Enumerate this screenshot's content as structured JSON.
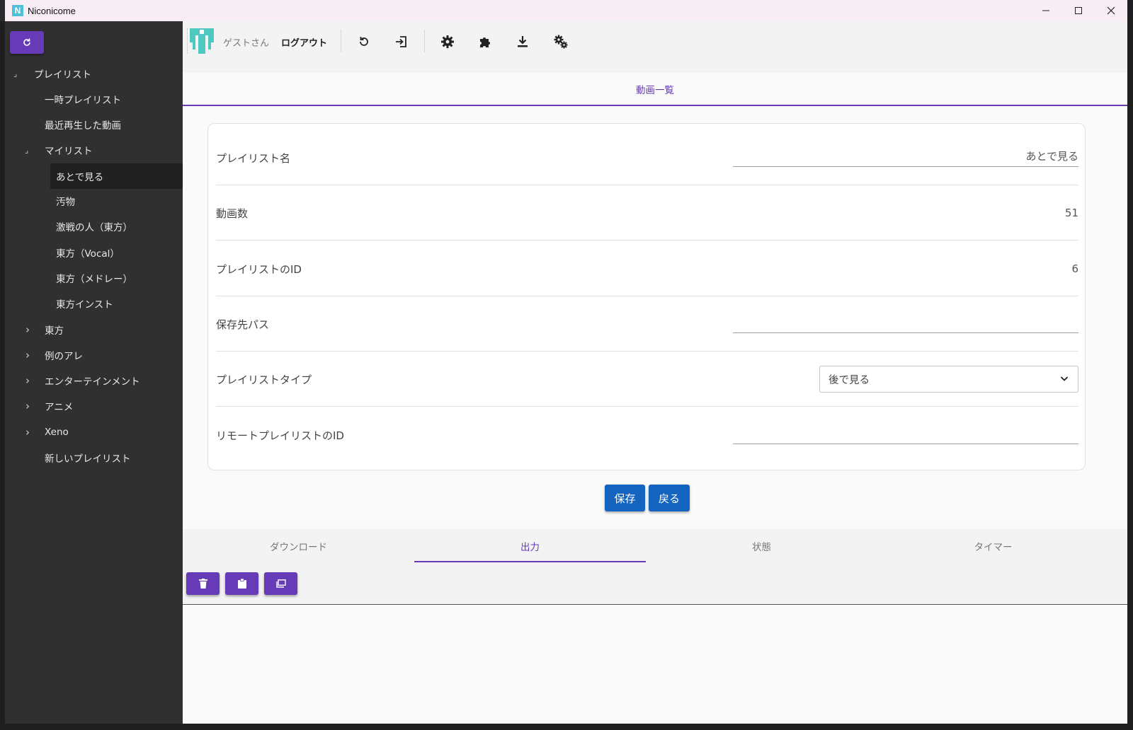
{
  "window": {
    "title": "Niconicome",
    "app_icon_letter": "N"
  },
  "sidebar": {
    "items": [
      {
        "label": "プレイリスト",
        "toggle": "⌟"
      },
      {
        "label": "一時プレイリスト"
      },
      {
        "label": "最近再生した動画"
      },
      {
        "label": "マイリスト",
        "toggle": "⌟"
      },
      {
        "label": "あとで見る",
        "selected": true
      },
      {
        "label": "汚物"
      },
      {
        "label": "激戦の人（東方）"
      },
      {
        "label": "東方（Vocal）"
      },
      {
        "label": "東方（メドレー）"
      },
      {
        "label": "東方インスト"
      },
      {
        "label": "東方",
        "toggle": "›"
      },
      {
        "label": "例のアレ",
        "toggle": "›"
      },
      {
        "label": "エンターテインメント",
        "toggle": "›"
      },
      {
        "label": "アニメ",
        "toggle": "›"
      },
      {
        "label": "Xeno",
        "toggle": "›"
      },
      {
        "label": "新しいプレイリスト"
      }
    ]
  },
  "toolbar": {
    "guest_label": "ゲストさん",
    "logout_label": "ログアウト",
    "icons": [
      "restore-icon",
      "login-icon",
      "settings-icon",
      "puzzle-icon",
      "download-icon",
      "gears-icon"
    ]
  },
  "header": {
    "tab_label": "動画一覧"
  },
  "form": {
    "playlist_name_label": "プレイリスト名",
    "playlist_name_value": "あとで見る",
    "video_count_label": "動画数",
    "video_count_value": "51",
    "playlist_id_label": "プレイリストのID",
    "playlist_id_value": "6",
    "save_path_label": "保存先パス",
    "save_path_value": "",
    "playlist_type_label": "プレイリストタイプ",
    "playlist_type_value": "後で見る",
    "remote_id_label": "リモートプレイリストのID",
    "remote_id_value": ""
  },
  "actions": {
    "save_label": "保存",
    "back_label": "戻る"
  },
  "bottom_tabs": [
    {
      "label": "ダウンロード"
    },
    {
      "label": "出力",
      "active": true
    },
    {
      "label": "状態"
    },
    {
      "label": "タイマー"
    }
  ],
  "output_buttons": [
    "trash-icon",
    "clipboard-icon",
    "window-icon"
  ],
  "colors": {
    "accent": "#673ab7",
    "primary": "#1565c0",
    "sidebar_bg": "#303030"
  }
}
